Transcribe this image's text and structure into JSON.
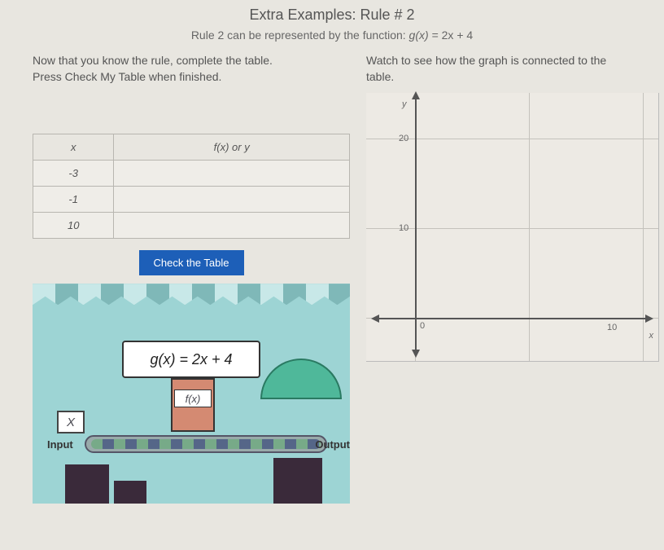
{
  "header": {
    "title": "Extra Examples: Rule # 2",
    "subtitle_pre": "Rule 2 can be represented by the function: ",
    "subtitle_fn": "g(x)",
    "subtitle_eq": " = ",
    "subtitle_expr": "2x + 4"
  },
  "left": {
    "instruction_l1": "Now that you know the rule, complete the table.",
    "instruction_l2": "Press Check My Table when finished.",
    "table": {
      "col_x": "x",
      "col_y": "f(x) or y",
      "rows": [
        {
          "x": "-3",
          "y": ""
        },
        {
          "x": "-1",
          "y": ""
        },
        {
          "x": "10",
          "y": ""
        }
      ]
    },
    "check_btn": "Check the Table"
  },
  "game": {
    "sign": "g(x) = 2x + 4",
    "machine_label": "f(x)",
    "x_box": "X",
    "input_label": "Input",
    "output_label": "Output"
  },
  "right": {
    "instruction_l1": "Watch to see how the graph is connected to the",
    "instruction_l2": "table."
  },
  "chart_data": {
    "type": "scatter",
    "title": "",
    "xlabel": "x",
    "ylabel": "y",
    "xlim": [
      -2,
      12
    ],
    "ylim": [
      -2,
      24
    ],
    "x_ticks": [
      0,
      10
    ],
    "y_ticks": [
      0,
      10,
      20
    ],
    "series": [
      {
        "name": "g(x)=2x+4",
        "values": []
      }
    ],
    "origin_label": "0",
    "tick_y_20": "20",
    "tick_y_10": "10",
    "tick_x_10": "10"
  }
}
